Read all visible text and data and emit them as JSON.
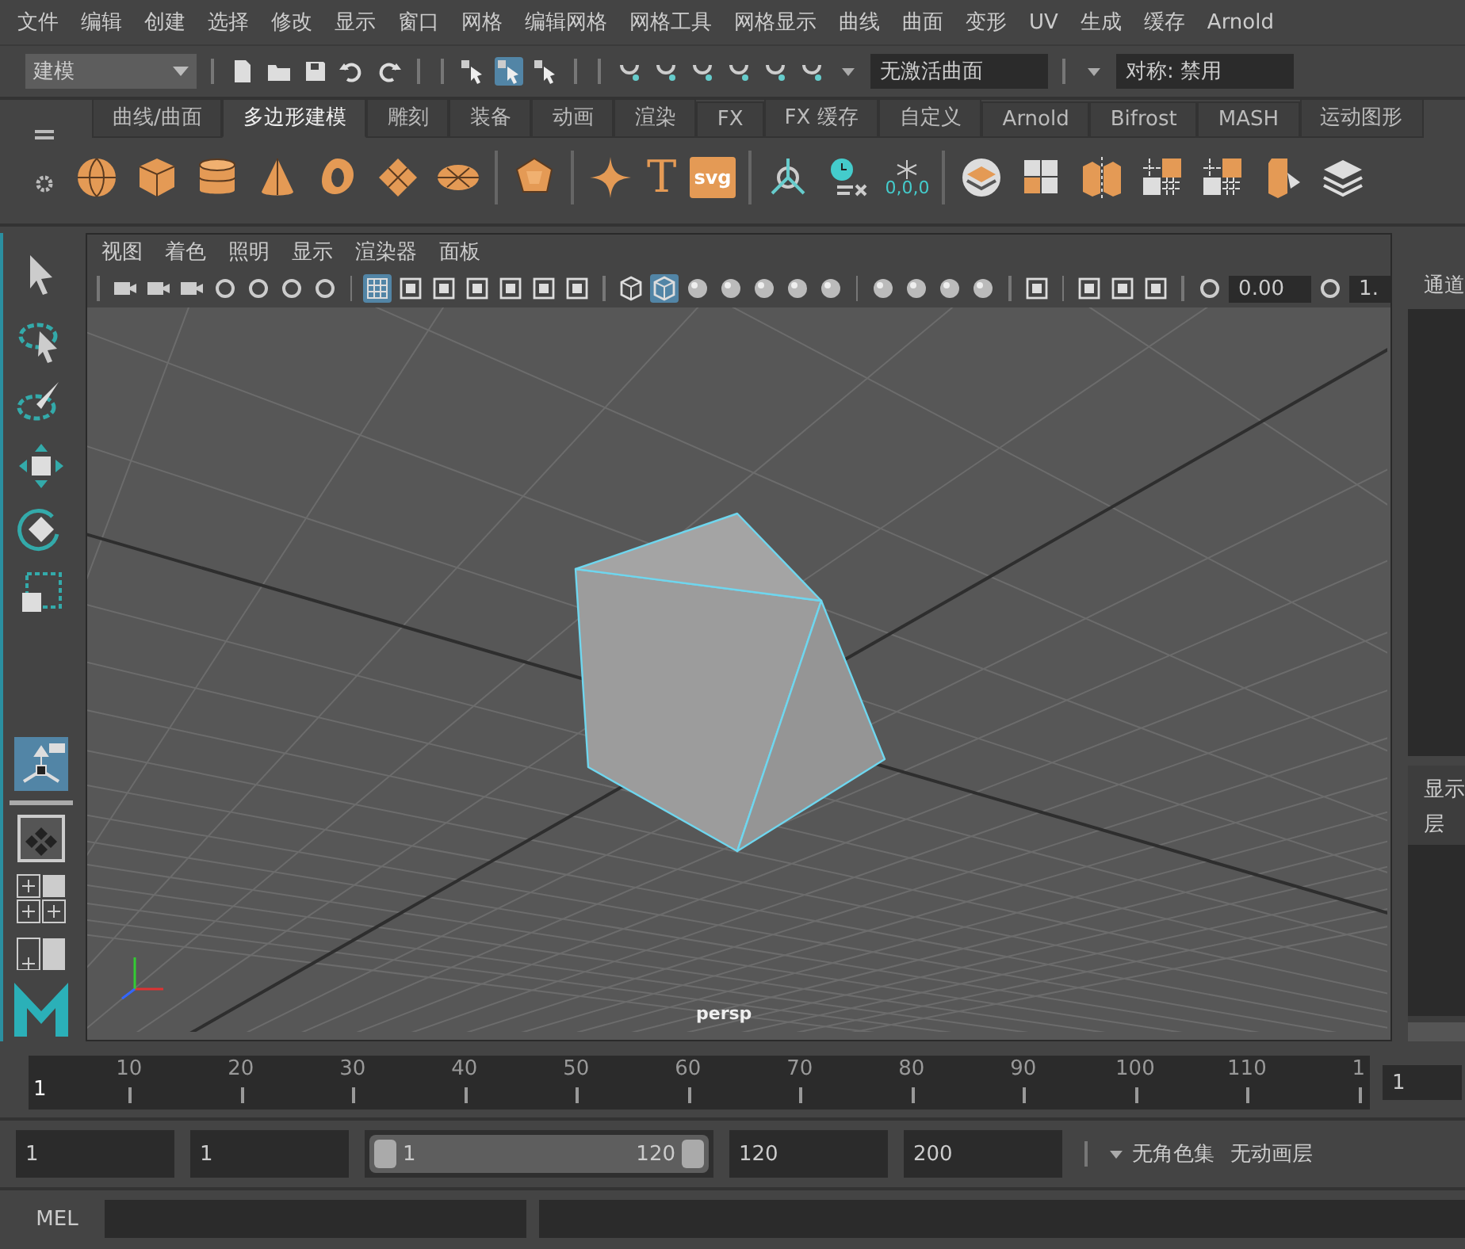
{
  "menu_bar": [
    "文件",
    "编辑",
    "创建",
    "选择",
    "修改",
    "显示",
    "窗口",
    "网格",
    "编辑网格",
    "网格工具",
    "网格显示",
    "曲线",
    "曲面",
    "变形",
    "UV",
    "生成",
    "缓存",
    "Arnold"
  ],
  "toolbar": {
    "mode_dropdown": "建模",
    "selection_mask_buttons": [
      {
        "selected": false
      },
      {
        "selected": true
      },
      {
        "selected": false
      }
    ],
    "live_surface": "无激活曲面",
    "symmetry": "对称: 禁用"
  },
  "shelf": {
    "tabs": [
      {
        "label": "曲线/曲面",
        "selected": false
      },
      {
        "label": "多边形建模",
        "selected": true
      },
      {
        "label": "雕刻",
        "selected": false
      },
      {
        "label": "装备",
        "selected": false
      },
      {
        "label": "动画",
        "selected": false
      },
      {
        "label": "渲染",
        "selected": false
      },
      {
        "label": "FX",
        "selected": false
      },
      {
        "label": "FX 缓存",
        "selected": false
      },
      {
        "label": "自定义",
        "selected": false
      },
      {
        "label": "Arnold",
        "selected": false
      },
      {
        "label": "Bifrost",
        "selected": false
      },
      {
        "label": "MASH",
        "selected": false
      },
      {
        "label": "运动图形",
        "selected": false
      }
    ],
    "type_tool": "T",
    "svg_tool": "svg",
    "freeze_label": "0,0,0"
  },
  "toolbox": {
    "tools": [
      {
        "selected": false
      },
      {
        "selected": false
      },
      {
        "selected": false
      },
      {
        "selected": false
      },
      {
        "selected": false
      },
      {
        "selected": false
      },
      {
        "selected": true
      }
    ]
  },
  "viewport": {
    "menu": [
      "视图",
      "着色",
      "照明",
      "显示",
      "渲染器",
      "面板"
    ],
    "panel_toggles": [
      {
        "selected": true
      },
      {
        "selected": false
      },
      {
        "selected": false
      },
      {
        "selected": false
      },
      {
        "selected": false
      },
      {
        "selected": false
      },
      {
        "selected": false
      }
    ],
    "shading_toggles": [
      {
        "selected": false
      },
      {
        "selected": true
      },
      {
        "selected": false
      },
      {
        "selected": false
      },
      {
        "selected": false
      },
      {
        "selected": false
      },
      {
        "selected": false
      }
    ],
    "exposure": "0.00",
    "gamma": "1.",
    "camera_name": "persp"
  },
  "channel_box": {
    "title": "通道",
    "layer_tabs": "显示",
    "layer_label": "层"
  },
  "timeline": {
    "ticks": [
      "10",
      "20",
      "30",
      "40",
      "50",
      "60",
      "70",
      "80",
      "90",
      "100",
      "110",
      "1"
    ],
    "current_frame": "1",
    "current_frame_field": "1"
  },
  "range": {
    "start": "1",
    "playback_start": "1",
    "slider_start": "1",
    "slider_range": {
      "level": 1
    },
    "slider_end": "120",
    "playback_end": "120",
    "end": "200",
    "character_set": "无角色集",
    "anim_layer": "无动画层"
  },
  "command_line": {
    "language": "MEL"
  }
}
